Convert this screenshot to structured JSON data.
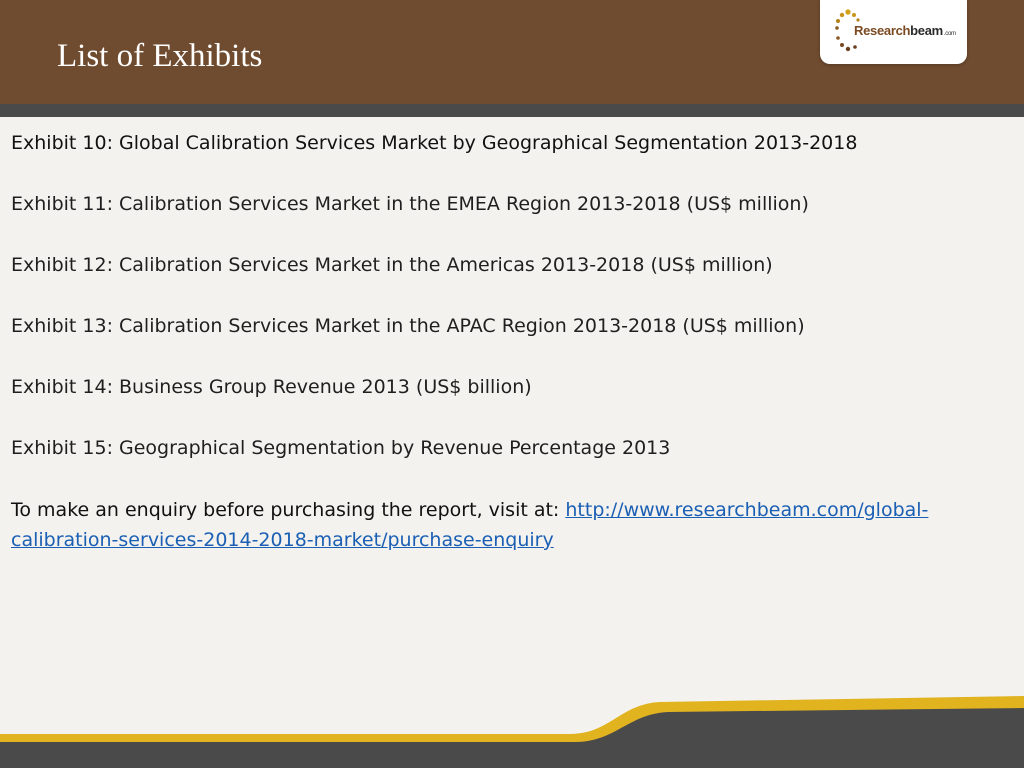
{
  "slide": {
    "title": "List of Exhibits"
  },
  "logo": {
    "initial": "R",
    "research": "esearch",
    "beam": "beam",
    "suffix": ".com"
  },
  "exhibits": [
    {
      "label": "Exhibit 10: Global Calibration Services Market by Geographical Segmentation 2013-2018"
    },
    {
      "label": "Exhibit 11: Calibration Services Market in the EMEA Region 2013-2018 (US$ million)"
    },
    {
      "label": "Exhibit 12: Calibration Services Market in the Americas 2013-2018 (US$ million)"
    },
    {
      "label": "Exhibit 13: Calibration Services Market in the APAC Region 2013-2018 (US$ million)"
    },
    {
      "label": "Exhibit 14: Business Group Revenue 2013 (US$ billion)"
    },
    {
      "label": "Exhibit 15: Geographical Segmentation by Revenue Percentage 2013"
    }
  ],
  "enquiry": {
    "prefix": "To make an enquiry before purchasing the report, visit at: ",
    "link_text": "http://www.researchbeam.com/global-calibration-services-2014-2018-market/purchase-enquiry"
  },
  "colors": {
    "header": "#6f4b2f",
    "band": "#4a4a4a",
    "accent_gold": "#e0b31f",
    "link": "#1a5fb4"
  }
}
